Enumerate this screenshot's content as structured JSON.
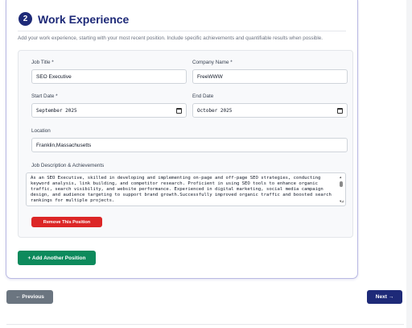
{
  "section": {
    "step_number": "2",
    "title": "Work Experience",
    "intro": "Add your work experience, starting with your most recent position. Include specific achievements and quantifiable results when possible."
  },
  "position": {
    "job_title_label": "Job Title *",
    "job_title_value": "SEO Executive",
    "company_label": "Company Name *",
    "company_value": "FreeWWW",
    "start_date_label": "Start Date *",
    "start_date_value": "September 2025",
    "end_date_label": "End Date",
    "end_date_value": "October 2025",
    "location_label": "Location",
    "location_value": "Franklin,Massachusetts",
    "description_label": "Job Description & Achievements",
    "description_value": "As an SEO Executive, skilled in developing and implementing on-page and off-page SEO strategies, conducting keyword analysis, link building, and competitor research. Proficient in using SEO tools to enhance organic traffic, search visibility, and website performance. Experienced in digital marketing, social media campaign design, and audience targeting to support brand growth.Successfully improved organic traffic and boosted search rankings for multiple projects.",
    "remove_label": "Remove This Position"
  },
  "actions": {
    "add_label": "+ Add Another Position",
    "previous_label": "← Previous",
    "next_label": "Next →"
  },
  "colors": {
    "primary": "#1e2a78",
    "danger": "#dc2626",
    "success": "#0d8a5c",
    "secondary": "#6b7580"
  },
  "icons": {
    "date_picker": "calendar-icon",
    "scroll": "scrollbar"
  }
}
